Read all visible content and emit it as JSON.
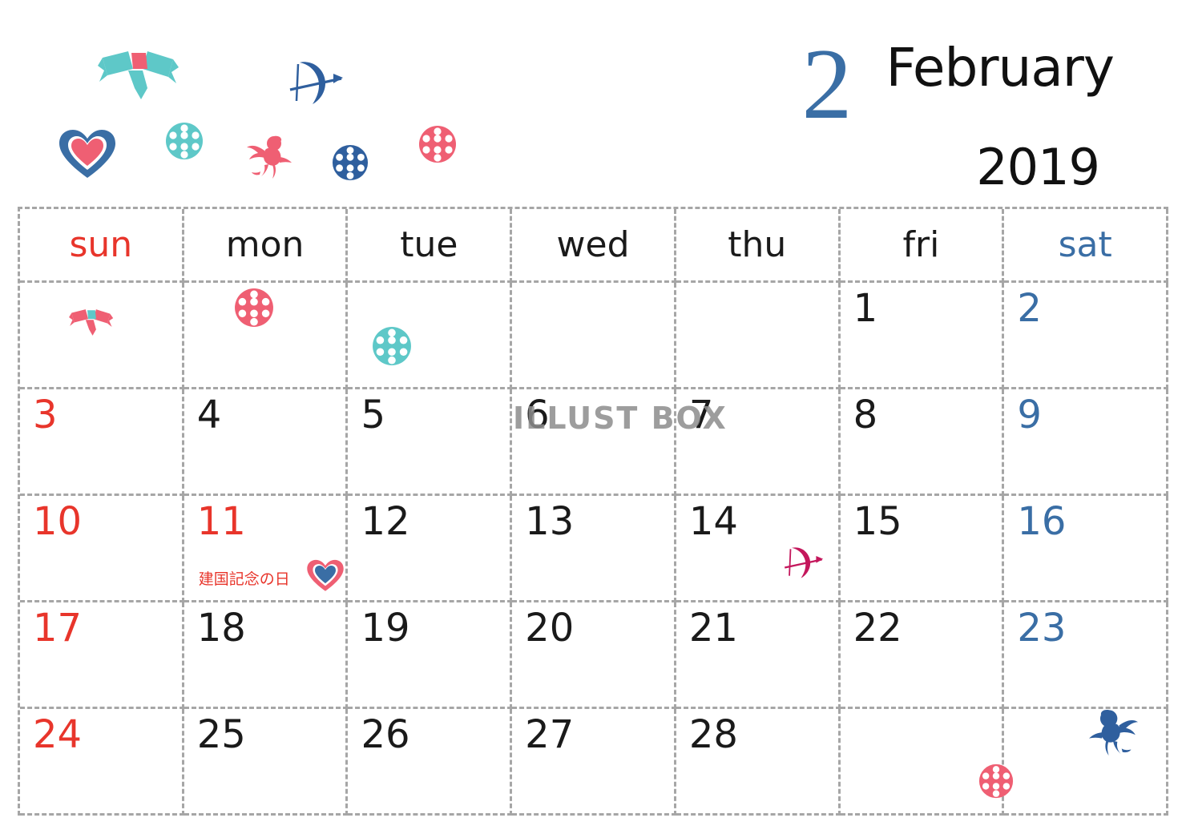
{
  "header": {
    "month_number": "2",
    "month_name": "February",
    "year": "2019"
  },
  "watermark": {
    "text": "ILLUST BOX"
  },
  "colors": {
    "sunday_red": "#e8352b",
    "saturday_blue": "#3a6ea5",
    "weekday_black": "#1a1a1a",
    "grid_gray": "#a6a6a6",
    "deco_pink": "#ef5f73",
    "deco_teal": "#5ec8c8",
    "deco_blue": "#3a6ea5",
    "deco_crimson": "#c4175c",
    "background": "#ffffff"
  },
  "weekdays": [
    {
      "label": "sun",
      "kind": "sun"
    },
    {
      "label": "mon",
      "kind": "day"
    },
    {
      "label": "tue",
      "kind": "day"
    },
    {
      "label": "wed",
      "kind": "day"
    },
    {
      "label": "thu",
      "kind": "day"
    },
    {
      "label": "fri",
      "kind": "day"
    },
    {
      "label": "sat",
      "kind": "sat"
    }
  ],
  "weeks": [
    [
      {
        "day": "",
        "kind": "empty"
      },
      {
        "day": "",
        "kind": "empty"
      },
      {
        "day": "",
        "kind": "empty"
      },
      {
        "day": "",
        "kind": "empty"
      },
      {
        "day": "",
        "kind": "empty"
      },
      {
        "day": "1",
        "kind": "day"
      },
      {
        "day": "2",
        "kind": "sat"
      }
    ],
    [
      {
        "day": "3",
        "kind": "sun"
      },
      {
        "day": "4",
        "kind": "day"
      },
      {
        "day": "5",
        "kind": "day"
      },
      {
        "day": "6",
        "kind": "day"
      },
      {
        "day": "7",
        "kind": "day"
      },
      {
        "day": "8",
        "kind": "day"
      },
      {
        "day": "9",
        "kind": "sat"
      }
    ],
    [
      {
        "day": "10",
        "kind": "sun"
      },
      {
        "day": "11",
        "kind": "sun",
        "holiday": "建国記念の日"
      },
      {
        "day": "12",
        "kind": "day"
      },
      {
        "day": "13",
        "kind": "day"
      },
      {
        "day": "14",
        "kind": "day"
      },
      {
        "day": "15",
        "kind": "day"
      },
      {
        "day": "16",
        "kind": "sat"
      }
    ],
    [
      {
        "day": "17",
        "kind": "sun"
      },
      {
        "day": "18",
        "kind": "day"
      },
      {
        "day": "19",
        "kind": "day"
      },
      {
        "day": "20",
        "kind": "day"
      },
      {
        "day": "21",
        "kind": "day"
      },
      {
        "day": "22",
        "kind": "day"
      },
      {
        "day": "23",
        "kind": "sat"
      }
    ],
    [
      {
        "day": "24",
        "kind": "sun"
      },
      {
        "day": "25",
        "kind": "day"
      },
      {
        "day": "26",
        "kind": "day"
      },
      {
        "day": "27",
        "kind": "day"
      },
      {
        "day": "28",
        "kind": "day"
      },
      {
        "day": "",
        "kind": "empty"
      },
      {
        "day": "",
        "kind": "empty"
      }
    ]
  ],
  "decorations": [
    {
      "name": "ribbon-bow-teal",
      "area": "header"
    },
    {
      "name": "bow-and-arrow-blue",
      "area": "header"
    },
    {
      "name": "heart-blue-pink",
      "area": "header"
    },
    {
      "name": "polkadot-circle-teal",
      "area": "header"
    },
    {
      "name": "cupid-pink",
      "area": "header"
    },
    {
      "name": "polkadot-circle-blue",
      "area": "header"
    },
    {
      "name": "polkadot-circle-pink",
      "area": "header"
    },
    {
      "name": "ribbon-bow-pink",
      "area": "week1-sun"
    },
    {
      "name": "polkadot-circle-pink",
      "area": "week1-mon"
    },
    {
      "name": "polkadot-circle-teal",
      "area": "week1-tue"
    },
    {
      "name": "heart-pink-blue",
      "area": "week3-mon"
    },
    {
      "name": "bow-and-arrow-crimson",
      "area": "week3-thu"
    },
    {
      "name": "polkadot-circle-pink",
      "area": "week5-fri"
    },
    {
      "name": "cupid-blue",
      "area": "week5-sat"
    }
  ]
}
